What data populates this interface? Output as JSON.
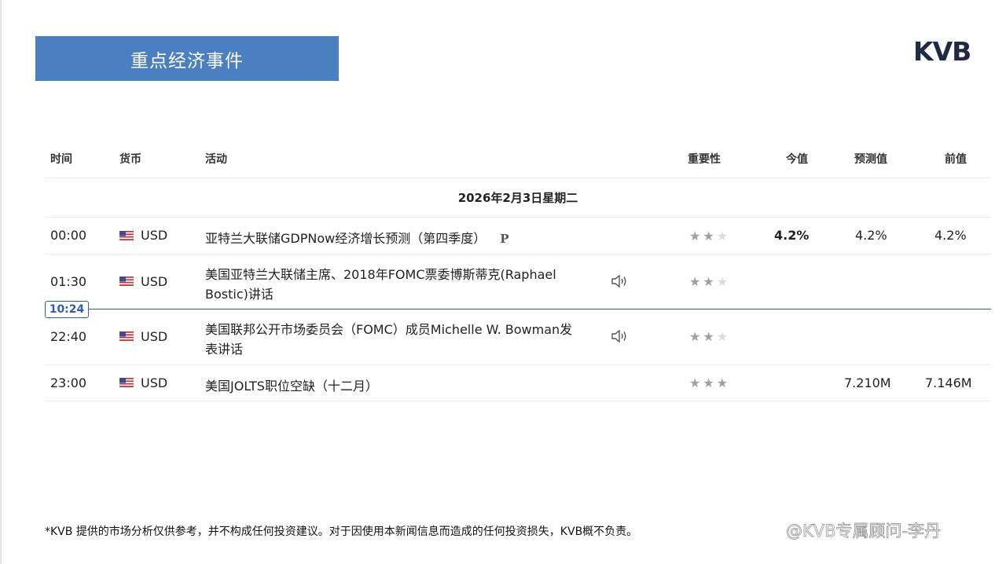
{
  "title": "重点经济事件",
  "logo": "KVB",
  "columns": {
    "time": "时间",
    "currency": "货币",
    "event": "活动",
    "importance": "重要性",
    "actual": "今值",
    "forecast": "预测值",
    "previous": "前值"
  },
  "date_label": "2026年2月3日星期二",
  "now_time": "10:24",
  "rows": [
    {
      "time": "00:00",
      "currency": "USD",
      "event": "亚特兰大联储GDPNow经济增长预测（第四季度）",
      "badge": "P",
      "importance": 2,
      "actual": "4.2%",
      "forecast": "4.2%",
      "previous": "4.2%"
    },
    {
      "time": "01:30",
      "currency": "USD",
      "event_line1": "美国亚特兰大联储主席、2018年FOMC票委博斯蒂克(Raphael",
      "event_line2": "Bostic)讲话",
      "icon": "speaker-icon",
      "importance": 2,
      "actual": "",
      "forecast": "",
      "previous": ""
    },
    {
      "time": "22:40",
      "currency": "USD",
      "event_line1": "美国联邦公开市场委员会（FOMC）成员Michelle W. Bowman发",
      "event_line2": "表讲话",
      "icon": "speaker-icon",
      "importance": 2,
      "actual": "",
      "forecast": "",
      "previous": ""
    },
    {
      "time": "23:00",
      "currency": "USD",
      "event": "美国JOLTS职位空缺（十二月）",
      "importance": 3,
      "actual": "",
      "forecast": "7.210M",
      "previous": "7.146M"
    }
  ],
  "disclaimer": "*KVB 提供的市场分析仅供参考，并不构成任何投资建议。对于因使用本新闻信息而造成的任何投资损失，KVB概不负责。",
  "watermark": "@KVB专属顾问-李丹",
  "colors": {
    "title_bg": "#4a7fc1",
    "now_line": "#2f5fa7",
    "logo": "#1f2a44"
  }
}
